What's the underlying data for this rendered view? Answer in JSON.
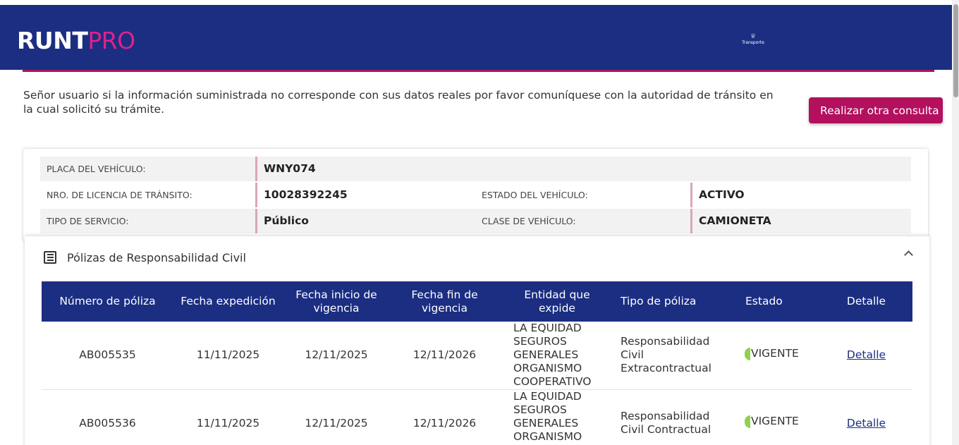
{
  "header": {
    "logo_runt": "RUNT",
    "logo_pro": "PRO",
    "ministry_label": "Transporte"
  },
  "notice": {
    "text": "Señor usuario si la información suministrada no corresponde con sus datos reales por favor comuníquese con la autoridad de tránsito en la cual solicitó su trámite.",
    "button_label": "Realizar otra consulta"
  },
  "vehicle": {
    "placa_label": "PLACA DEL VEHÍCULO:",
    "placa_value": "WNY074",
    "licencia_label": "NRO. DE LICENCIA DE TRÁNSITO:",
    "licencia_value": "10028392245",
    "estado_label": "ESTADO DEL VEHÍCULO:",
    "estado_value": "ACTIVO",
    "servicio_label": "TIPO DE SERVICIO:",
    "servicio_value": "Público",
    "clase_label": "CLASE DE VEHÍCULO:",
    "clase_value": "CAMIONETA"
  },
  "polizas": {
    "title": "Pólizas de Responsabilidad Civil",
    "columns": [
      "Número de póliza",
      "Fecha expedición",
      "Fecha inicio de vigencia",
      "Fecha fin de vigencia",
      "Entidad que expide",
      "Tipo de póliza",
      "Estado",
      "Detalle"
    ],
    "rows": [
      {
        "numero": "AB005535",
        "expedicion": "11/11/2025",
        "inicio": "12/11/2025",
        "fin": "12/11/2026",
        "entidad": "LA EQUIDAD SEGUROS GENERALES ORGANISMO COOPERATIVO",
        "tipo": "Responsabilidad Civil Extracontractual",
        "estado": "VIGENTE",
        "detalle": "Detalle"
      },
      {
        "numero": "AB005536",
        "expedicion": "11/11/2025",
        "inicio": "12/11/2025",
        "fin": "12/11/2026",
        "entidad": "LA EQUIDAD SEGUROS GENERALES ORGANISMO COOPERATIVO",
        "tipo": "Responsabilidad Civil Contractual",
        "estado": "VIGENTE",
        "detalle": "Detalle"
      }
    ]
  }
}
